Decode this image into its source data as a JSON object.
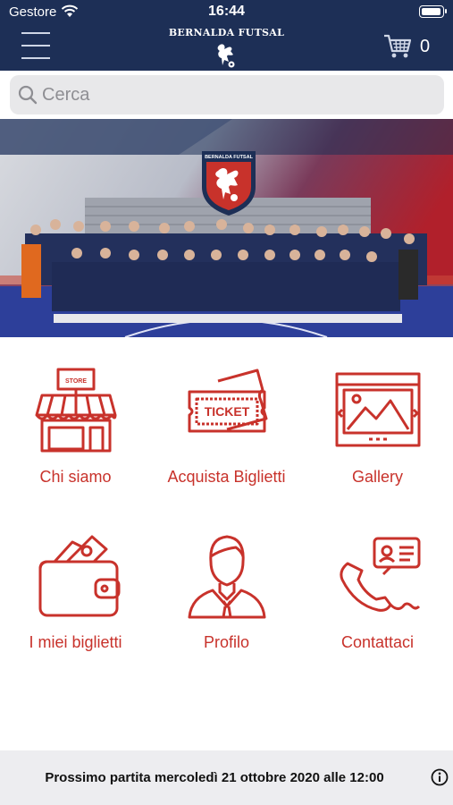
{
  "status_bar": {
    "carrier": "Gestore",
    "time": "16:44",
    "battery_level": 1.0
  },
  "header": {
    "brand_name": "BERNALDA FUTSAL",
    "cart_count": "0",
    "menu_icon": "hamburger-menu-icon",
    "cart_icon": "shopping-cart-icon"
  },
  "search": {
    "placeholder": "Cerca",
    "value": ""
  },
  "banner": {
    "crest_text": "BERNALDA FUTSAL"
  },
  "tiles": [
    {
      "label": "Chi siamo",
      "icon": "store-icon",
      "icon_text": "STORE"
    },
    {
      "label": "Acquista Biglietti",
      "icon": "ticket-icon",
      "icon_text": "TICKET"
    },
    {
      "label": "Gallery",
      "icon": "gallery-icon"
    },
    {
      "label": "I miei biglietti",
      "icon": "wallet-icon"
    },
    {
      "label": "Profilo",
      "icon": "profile-icon"
    },
    {
      "label": "Contattaci",
      "icon": "contact-phone-icon"
    }
  ],
  "footer": {
    "next_match": "Prossimo partita mercoledì 21 ottobre 2020 alle 12:00",
    "info_icon": "info-icon"
  },
  "colors": {
    "header_bg": "#1d2f56",
    "accent": "#c8322b",
    "footer_bg": "#ededf0"
  }
}
